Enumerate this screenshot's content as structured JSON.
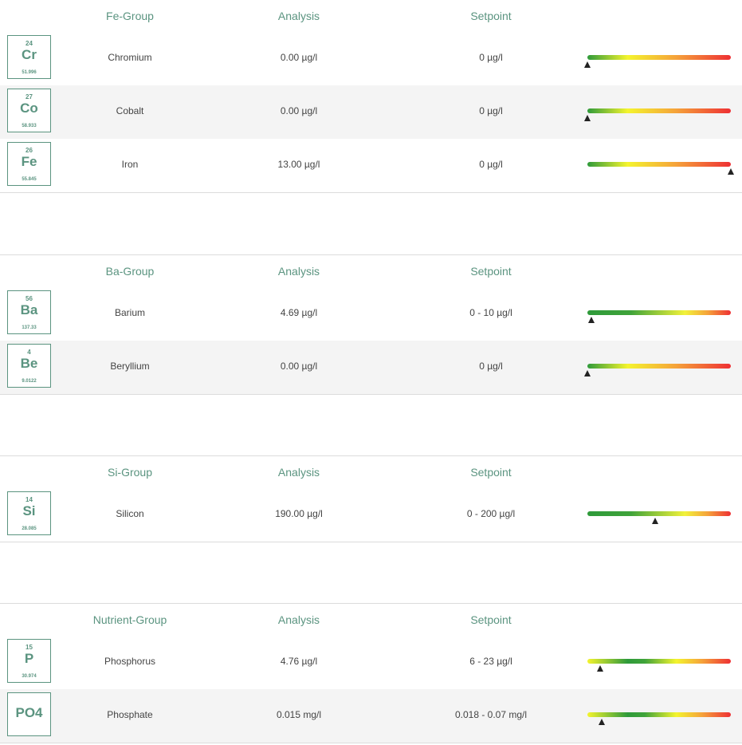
{
  "groups": [
    {
      "header": {
        "name": "Fe-Group",
        "analysis": "Analysis",
        "setpoint": "Setpoint"
      },
      "rows": [
        {
          "number": "24",
          "symbol": "Cr",
          "mass": "51.996",
          "name": "Chromium",
          "analysis": "0.00 µg/l",
          "setpoint": "0 µg/l",
          "marker": 0.0
        },
        {
          "number": "27",
          "symbol": "Co",
          "mass": "58.933",
          "name": "Cobalt",
          "analysis": "0.00 µg/l",
          "setpoint": "0 µg/l",
          "marker": 0.0
        },
        {
          "number": "26",
          "symbol": "Fe",
          "mass": "55.845",
          "name": "Iron",
          "analysis": "13.00 µg/l",
          "setpoint": "0 µg/l",
          "marker": 1.0
        }
      ]
    },
    {
      "header": {
        "name": "Ba-Group",
        "analysis": "Analysis",
        "setpoint": "Setpoint"
      },
      "rows": [
        {
          "number": "56",
          "symbol": "Ba",
          "mass": "137.33",
          "name": "Barium",
          "analysis": "4.69 µg/l",
          "setpoint": "0 - 10 µg/l",
          "marker": 0.03
        },
        {
          "number": "4",
          "symbol": "Be",
          "mass": "9.0122",
          "name": "Beryllium",
          "analysis": "0.00 µg/l",
          "setpoint": "0 µg/l",
          "marker": 0.0
        }
      ]
    },
    {
      "header": {
        "name": "Si-Group",
        "analysis": "Analysis",
        "setpoint": "Setpoint"
      },
      "rows": [
        {
          "number": "14",
          "symbol": "Si",
          "mass": "28.085",
          "name": "Silicon",
          "analysis": "190.00 µg/l",
          "setpoint": "0 - 200 µg/l",
          "marker": 0.47
        }
      ]
    },
    {
      "header": {
        "name": "Nutrient-Group",
        "analysis": "Analysis",
        "setpoint": "Setpoint"
      },
      "rows": [
        {
          "number": "15",
          "symbol": "P",
          "mass": "30.974",
          "name": "Phosphorus",
          "analysis": "4.76 µg/l",
          "setpoint": "6 - 23 µg/l",
          "marker": 0.09
        },
        {
          "number": "",
          "symbol": "PO4",
          "mass": "",
          "name": "Phosphate",
          "analysis": "0.015 mg/l",
          "setpoint": "0.018 - 0.07 mg/l",
          "marker": 0.1
        }
      ]
    }
  ],
  "colors": {
    "accent": "#5b9480",
    "alt_row": "#f4f4f4",
    "border": "#dcdcdc",
    "marker": "#222222"
  }
}
